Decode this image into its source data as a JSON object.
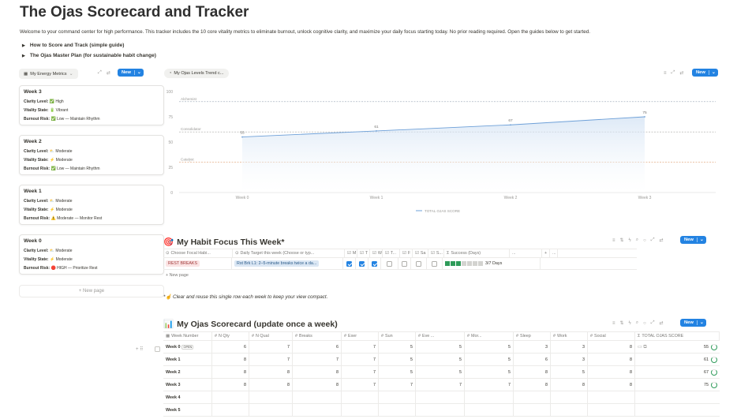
{
  "page": {
    "title": "The Ojas Scorecard and Tracker",
    "intro": "Welcome to your command center for high performance. This tracker includes the 10 core vitality metrics to eliminate burnout, unlock cognitive clarity, and maximize your daily focus starting today. No prior reading required. Open the guides below to get started.",
    "toggles": [
      "How to Score and Track (simple guide)",
      "The Ojas Master Plan (for sustainable habit change)"
    ]
  },
  "gallery": {
    "view_label": "My Energy Metrics",
    "new_label": "New",
    "new_page": "+ New page",
    "cards": [
      {
        "title": "Week 3",
        "clarity": "High",
        "clarity_icon": "✅",
        "vitality": "Vibrant",
        "vitality_icon": "🔋",
        "risk": "Low — Maintain Rhythm",
        "risk_icon": "✅"
      },
      {
        "title": "Week 2",
        "clarity": "Moderate",
        "clarity_icon": "⛅",
        "vitality": "Moderate",
        "vitality_icon": "⚡",
        "risk": "Low — Maintain Rhythm",
        "risk_icon": "✅"
      },
      {
        "title": "Week 1",
        "clarity": "Moderate",
        "clarity_icon": "⛅",
        "vitality": "Moderate",
        "vitality_icon": "⚡",
        "risk": "Moderate — Monitor Rest",
        "risk_icon": "⚠️"
      },
      {
        "title": "Week 0",
        "clarity": "Moderate",
        "clarity_icon": "⛅",
        "vitality": "Moderate",
        "vitality_icon": "⚡",
        "risk": "HIGH — Prioritize Rest",
        "risk_icon": "🛑"
      }
    ],
    "labels": {
      "clarity": "Clarity Level:",
      "vitality": "Vitality State:",
      "risk": "Burnout Risk:"
    }
  },
  "chart_view": {
    "label": "My Ojas Levels Trend c...",
    "new_label": "New"
  },
  "chart_data": {
    "type": "line",
    "categories": [
      "Week 0",
      "Week 1",
      "Week 2",
      "Week 3"
    ],
    "series": [
      {
        "name": "TOTAL OJAS SCORE",
        "values": [
          55,
          61,
          67,
          75
        ]
      }
    ],
    "ylim": [
      0,
      100
    ],
    "yticks": [
      0,
      25,
      50,
      75,
      100
    ],
    "reference_lines": [
      {
        "label": "Alchemist",
        "value": 90,
        "color": "#9aa6b4"
      },
      {
        "label": "Consolidator",
        "value": 60,
        "color": "#a9a8a4"
      },
      {
        "label": "Catalyst",
        "value": 30,
        "color": "#e0a072"
      }
    ],
    "line_color": "#6ea0d8",
    "legend": "bottom"
  },
  "habit": {
    "title": "My Habit Focus This Week*",
    "icon": "🎯",
    "new_label": "New",
    "columns": [
      "Choose Focal Habi...",
      "Daily Target this week (Choose or typ...",
      "M",
      "T",
      "W",
      "T...",
      "F",
      "Sa",
      "S...",
      "Success (Days)",
      "...",
      "+",
      "..."
    ],
    "row": {
      "habit": "REST BREAKS",
      "target": "Rst Brk L1: 2–5-minute breaks twice a da...",
      "days": [
        true,
        true,
        true,
        false,
        false,
        false,
        false
      ],
      "success": "3/7 Days",
      "progress": 0.43
    },
    "new_page": "+ New page",
    "note": "Clear and reuse this single row each week to keep your view compact.",
    "note_prefix": "*☝️"
  },
  "scorecard": {
    "title": "My Ojas Scorecard (update once a week)",
    "icon": "📊",
    "new_label": "New",
    "columns": [
      "Week Number",
      "N Qty",
      "N Qual",
      "Breaks",
      "Exer",
      "Sun",
      "Eve ...",
      "Mor...",
      "Sleep",
      "Work",
      "Social",
      "TOTAL OJAS SCORE"
    ],
    "open_label": "OPEN",
    "rows": [
      {
        "week": "Week 0",
        "vals": [
          "6",
          "7",
          "6",
          "7",
          "5",
          "5",
          "5",
          "3",
          "3",
          "8"
        ],
        "total": "55"
      },
      {
        "week": "Week 1",
        "vals": [
          "8",
          "7",
          "7",
          "7",
          "5",
          "5",
          "5",
          "6",
          "3",
          "8"
        ],
        "total": "61"
      },
      {
        "week": "Week 2",
        "vals": [
          "8",
          "8",
          "8",
          "7",
          "5",
          "5",
          "5",
          "8",
          "5",
          "8"
        ],
        "total": "67"
      },
      {
        "week": "Week 3",
        "vals": [
          "8",
          "8",
          "8",
          "7",
          "7",
          "7",
          "7",
          "8",
          "8",
          "8"
        ],
        "total": "75"
      },
      {
        "week": "Week 4",
        "vals": [
          "",
          "",
          "",
          "",
          "",
          "",
          "",
          "",
          "",
          ""
        ],
        "total": ""
      },
      {
        "week": "Week 5",
        "vals": [
          "",
          "",
          "",
          "",
          "",
          "",
          "",
          "",
          "",
          ""
        ],
        "total": ""
      }
    ]
  }
}
